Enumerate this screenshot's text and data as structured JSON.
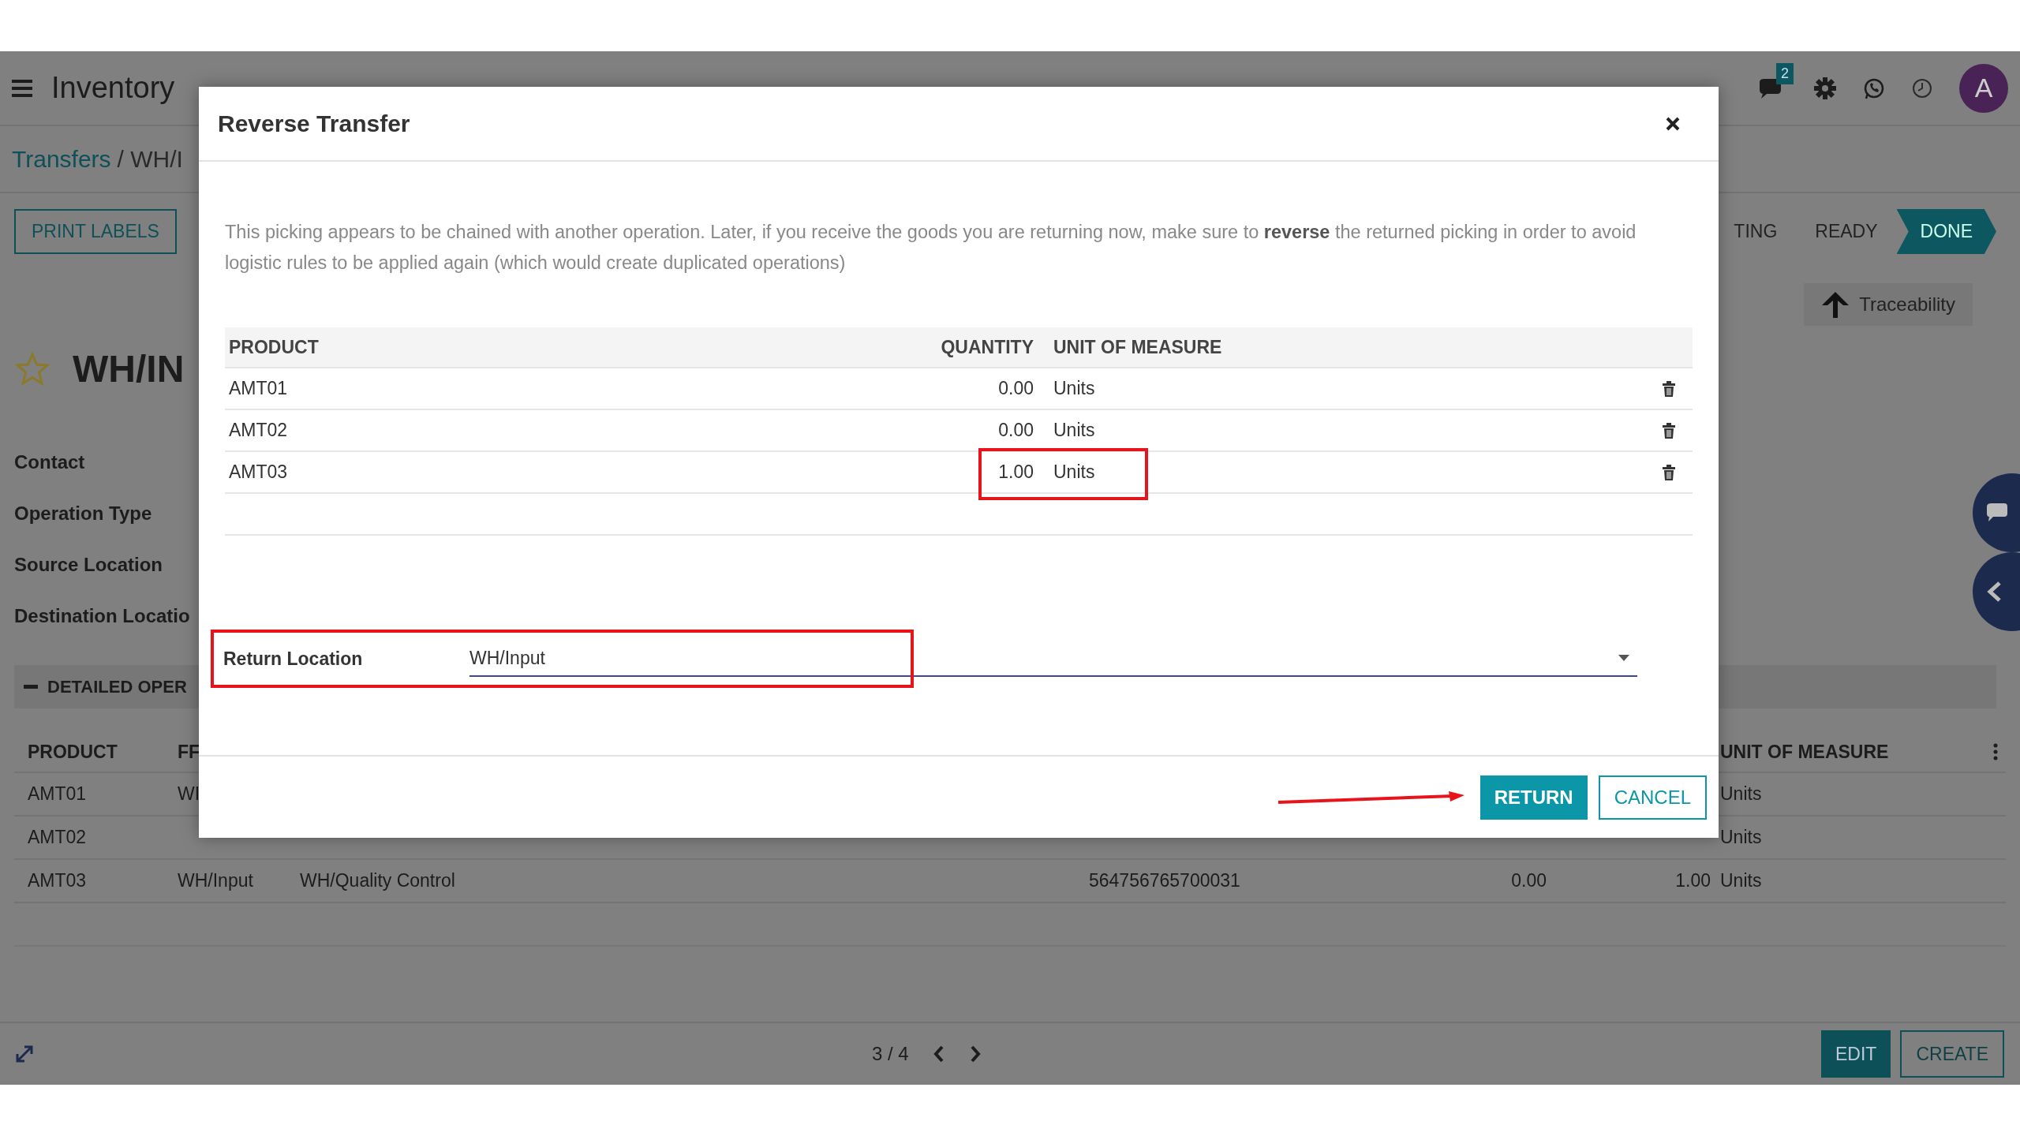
{
  "navbar": {
    "app_name": "Inventory",
    "message_count": "2",
    "avatar": "A"
  },
  "breadcrumb": [
    {
      "label": "Transfers",
      "link": true
    },
    {
      "label": "/ WH/I",
      "link": false
    }
  ],
  "buttons": [
    "PRINT LABELS"
  ],
  "status_steps": [
    {
      "label": "TING",
      "selected": false
    },
    {
      "label": "READY",
      "selected": false
    },
    {
      "label": "DONE",
      "selected": true
    }
  ],
  "smart_button": "Traceability",
  "record": {
    "title": "WH/IN",
    "starred": false
  },
  "fields": [
    "Contact",
    "Operation Type",
    "Source Location",
    "Destination Locatio"
  ],
  "section": {
    "title": "DETAILED OPER",
    "expanded": true
  },
  "operations": {
    "columns": {
      "product": "PRODUCT",
      "column_2": "FF",
      "unit_of_measure": "UNIT OF MEASURE"
    },
    "rows": [
      {
        "product": "AMT01",
        "column_2": "WI",
        "unit_of_measure": "Units"
      },
      {
        "product": "AMT02",
        "unit_of_measure": "Units"
      },
      {
        "product": "AMT03",
        "column_2": "WH/Input",
        "column_3": "WH/Quality Control",
        "column_4": "564756765700031",
        "column_5": "0.00",
        "column_6": "1.00",
        "unit_of_measure": "Units"
      }
    ]
  },
  "pager": "3 / 4",
  "footer_buttons": [
    {
      "label": "EDIT",
      "kind": "primary"
    },
    {
      "label": "CREATE",
      "kind": "secondary"
    }
  ],
  "modal": {
    "title": "Reverse Transfer",
    "message": "This picking appears to be chained with another operation. Later, if you receive the goods you are returning now, make sure to **reverse** the returned picking in order to avoid logistic rules to be applied again (which would create duplicated operations)",
    "columns": [
      "PRODUCT",
      "QUANTITY",
      "UNIT OF MEASURE"
    ],
    "lines": [
      {
        "product": "AMT01",
        "quantity": "0.00",
        "unit": "Units",
        "highlighted": false
      },
      {
        "product": "AMT02",
        "quantity": "0.00",
        "unit": "Units",
        "highlighted": false
      },
      {
        "product": "AMT03",
        "quantity": "1.00",
        "unit": "Units",
        "highlighted": true
      }
    ],
    "return_location": {
      "label": "Return Location",
      "value": "WH/Input",
      "highlighted": true
    },
    "buttons": [
      {
        "label": "RETURN",
        "kind": "primary",
        "pointed": true
      },
      {
        "label": "CANCEL",
        "kind": "secondary",
        "pointed": false
      }
    ]
  }
}
